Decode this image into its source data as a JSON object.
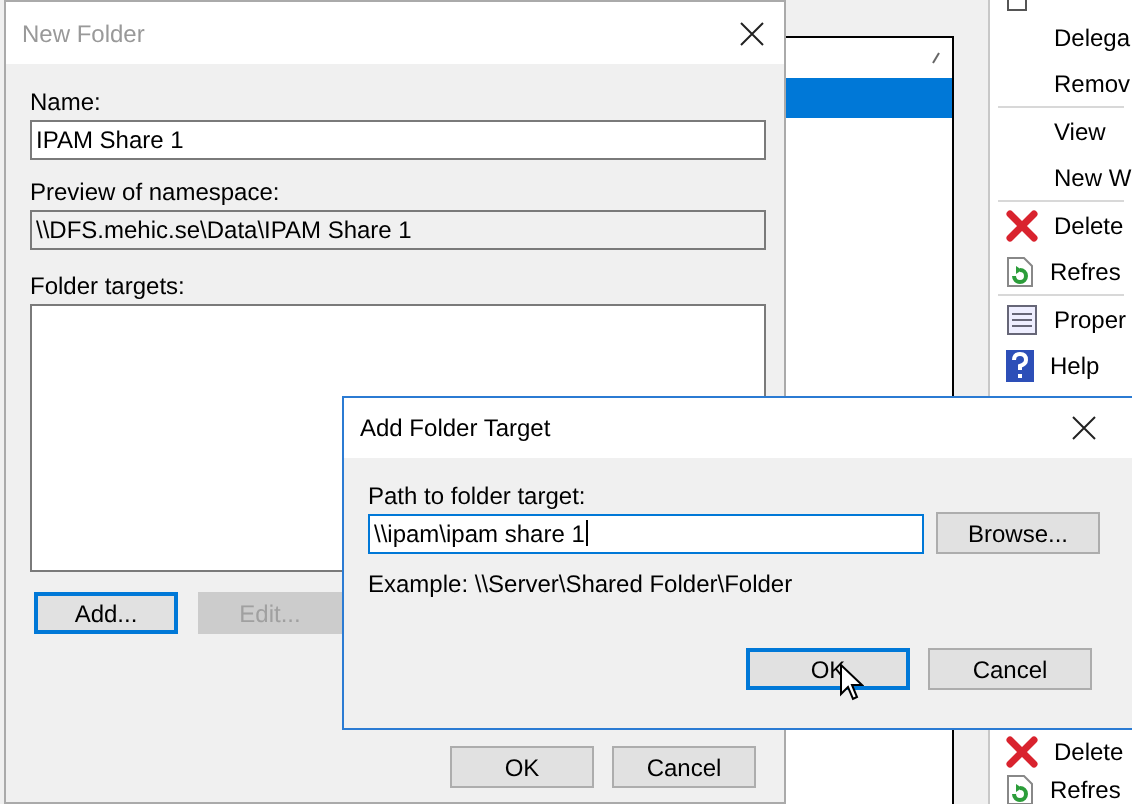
{
  "background_window": {
    "list": {
      "rows": [
        {
          "selected": true
        }
      ]
    },
    "actions": [
      {
        "kind": "new"
      },
      {
        "kind": "plain",
        "label": "Delega"
      },
      {
        "kind": "plain",
        "label": "Remov"
      },
      {
        "kind": "separator"
      },
      {
        "kind": "plain",
        "label": "View"
      },
      {
        "kind": "plain",
        "label": "New W"
      },
      {
        "kind": "separator"
      },
      {
        "kind": "delete",
        "label": "Delete"
      },
      {
        "kind": "refresh",
        "label": "Refres"
      },
      {
        "kind": "separator"
      },
      {
        "kind": "properties",
        "label": "Proper"
      },
      {
        "kind": "help",
        "label": "Help"
      }
    ],
    "lower_actions": [
      {
        "kind": "delete",
        "label": "Delete"
      },
      {
        "kind": "refresh",
        "label": "Refres"
      }
    ]
  },
  "new_folder": {
    "title": "New Folder",
    "active": false,
    "name_label": "Name:",
    "name_value": "IPAM Share 1",
    "preview_label": "Preview of namespace:",
    "preview_value": "\\\\DFS.mehic.se\\Data\\IPAM Share 1",
    "targets_label": "Folder targets:",
    "target_buttons": [
      {
        "label": "Add...",
        "disabled": false,
        "default": true
      },
      {
        "label": "Edit...",
        "disabled": true,
        "default": false
      }
    ],
    "ok": "OK",
    "cancel": "Cancel"
  },
  "add_target": {
    "title": "Add Folder Target",
    "active": true,
    "path_label": "Path to folder target:",
    "path_value": "\\\\ipam\\ipam share 1",
    "browse": "Browse...",
    "example": "Example: \\\\Server\\Shared Folder\\Folder",
    "ok": {
      "label": "OK",
      "default": true
    },
    "cancel": {
      "label": "Cancel",
      "default": false
    }
  }
}
